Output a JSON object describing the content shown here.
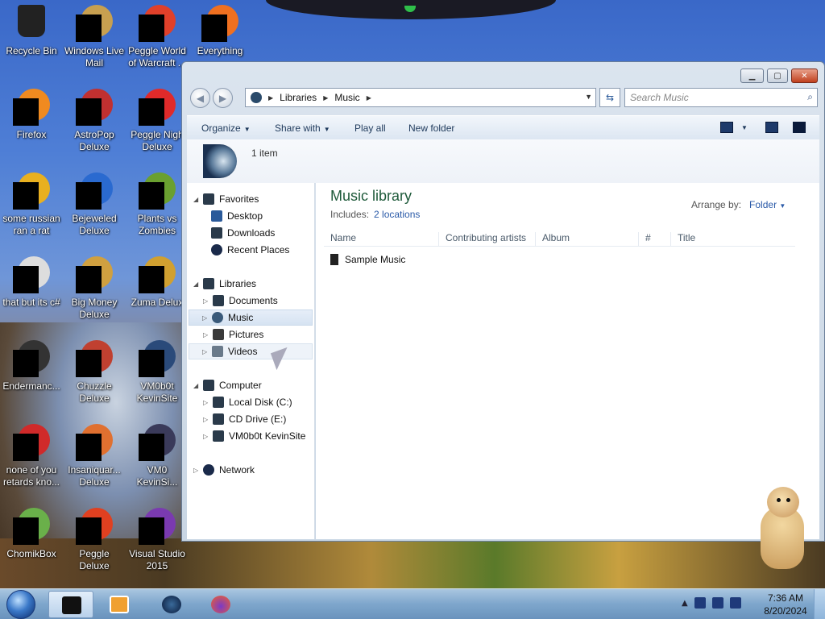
{
  "desktop": {
    "icons": [
      {
        "label": "Recycle Bin",
        "icon": "recycle-bin-icon"
      },
      {
        "label": "Windows Live Mail",
        "icon": "windows-live-mail-icon"
      },
      {
        "label": "Peggle World of Warcraft ...",
        "icon": "peggle-wow-icon"
      },
      {
        "label": "Everything",
        "icon": "everything-search-icon"
      },
      {
        "label": "Firefox",
        "icon": "firefox-icon"
      },
      {
        "label": "AstroPop Deluxe",
        "icon": "astropop-icon"
      },
      {
        "label": "Peggle Nigh Deluxe",
        "icon": "peggle-nights-icon"
      },
      {
        "label": "some russian ran a rat",
        "icon": "internet-explorer-icon"
      },
      {
        "label": "Bejeweled Deluxe",
        "icon": "bejeweled-icon"
      },
      {
        "label": "Plants vs Zombies",
        "icon": "plants-vs-zombies-icon"
      },
      {
        "label": "that but its c#",
        "icon": "stacked-windows-icon"
      },
      {
        "label": "Big Money Deluxe",
        "icon": "big-money-icon"
      },
      {
        "label": "Zuma Delux",
        "icon": "zuma-icon"
      },
      {
        "label": "Endermanc...",
        "icon": "program-icon"
      },
      {
        "label": "Chuzzle Deluxe",
        "icon": "chuzzle-icon"
      },
      {
        "label": "VM0b0t KevinSite",
        "icon": "vm-icon"
      },
      {
        "label": "none of you retards kno...",
        "icon": "opera-icon"
      },
      {
        "label": "Insaniquar... Deluxe",
        "icon": "insaniquarium-icon"
      },
      {
        "label": "VM0 KevinSi...",
        "icon": "vm-icon"
      },
      {
        "label": "ChomikBox",
        "icon": "chomikbox-icon"
      },
      {
        "label": "Peggle Deluxe",
        "icon": "peggle-icon"
      },
      {
        "label": "Visual Studio 2015",
        "icon": "visual-studio-icon"
      }
    ]
  },
  "window": {
    "address": {
      "root": "Libraries",
      "current": "Music"
    },
    "search_placeholder": "Search Music",
    "toolbar": {
      "organize": "Organize",
      "share_with": "Share with",
      "play_all": "Play all",
      "new_folder": "New folder"
    },
    "details": {
      "item_count": "1 item"
    },
    "nav": {
      "favorites": "Favorites",
      "desktop": "Desktop",
      "downloads": "Downloads",
      "recent_places": "Recent Places",
      "libraries": "Libraries",
      "documents": "Documents",
      "music": "Music",
      "pictures": "Pictures",
      "videos": "Videos",
      "computer": "Computer",
      "local_disk": "Local Disk (C:)",
      "cd_drive": "CD Drive (E:)",
      "vm_site": "VM0b0t KevinSite",
      "network": "Network"
    },
    "library": {
      "title": "Music library",
      "includes_label": "Includes:",
      "includes_link": "2 locations",
      "arrange_label": "Arrange by:",
      "arrange_value": "Folder"
    },
    "columns": [
      "Name",
      "Contributing artists",
      "Album",
      "#",
      "Title"
    ],
    "files": [
      {
        "name": "Sample Music"
      }
    ]
  },
  "taskbar": {
    "clock_time": "7:36 AM",
    "clock_date": "8/20/2024"
  }
}
